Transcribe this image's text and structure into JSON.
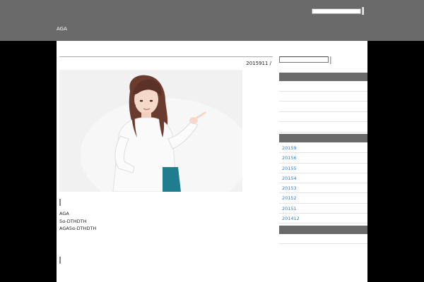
{
  "header": {
    "site_title": "AGA",
    "search": {
      "placeholder": ""
    }
  },
  "post": {
    "date": "2015911 /",
    "image": {
      "alt": ""
    },
    "lines": [
      "AGA",
      "5α-DTHDTH",
      "AGA5α-DTHDTH"
    ]
  },
  "sidebar": {
    "search": {
      "placeholder": ""
    },
    "archives": [
      "20159",
      "20156",
      "20155",
      "20154",
      "20153",
      "20152",
      "20151",
      "201412"
    ]
  },
  "colors": {
    "header_bg": "#6a6a6a",
    "page_bg": "#000000",
    "content_bg": "#ffffff",
    "widget_bar": "#6a6a6a",
    "link": "#3a7abf"
  },
  "icons": {
    "search_button": "search-icon"
  }
}
